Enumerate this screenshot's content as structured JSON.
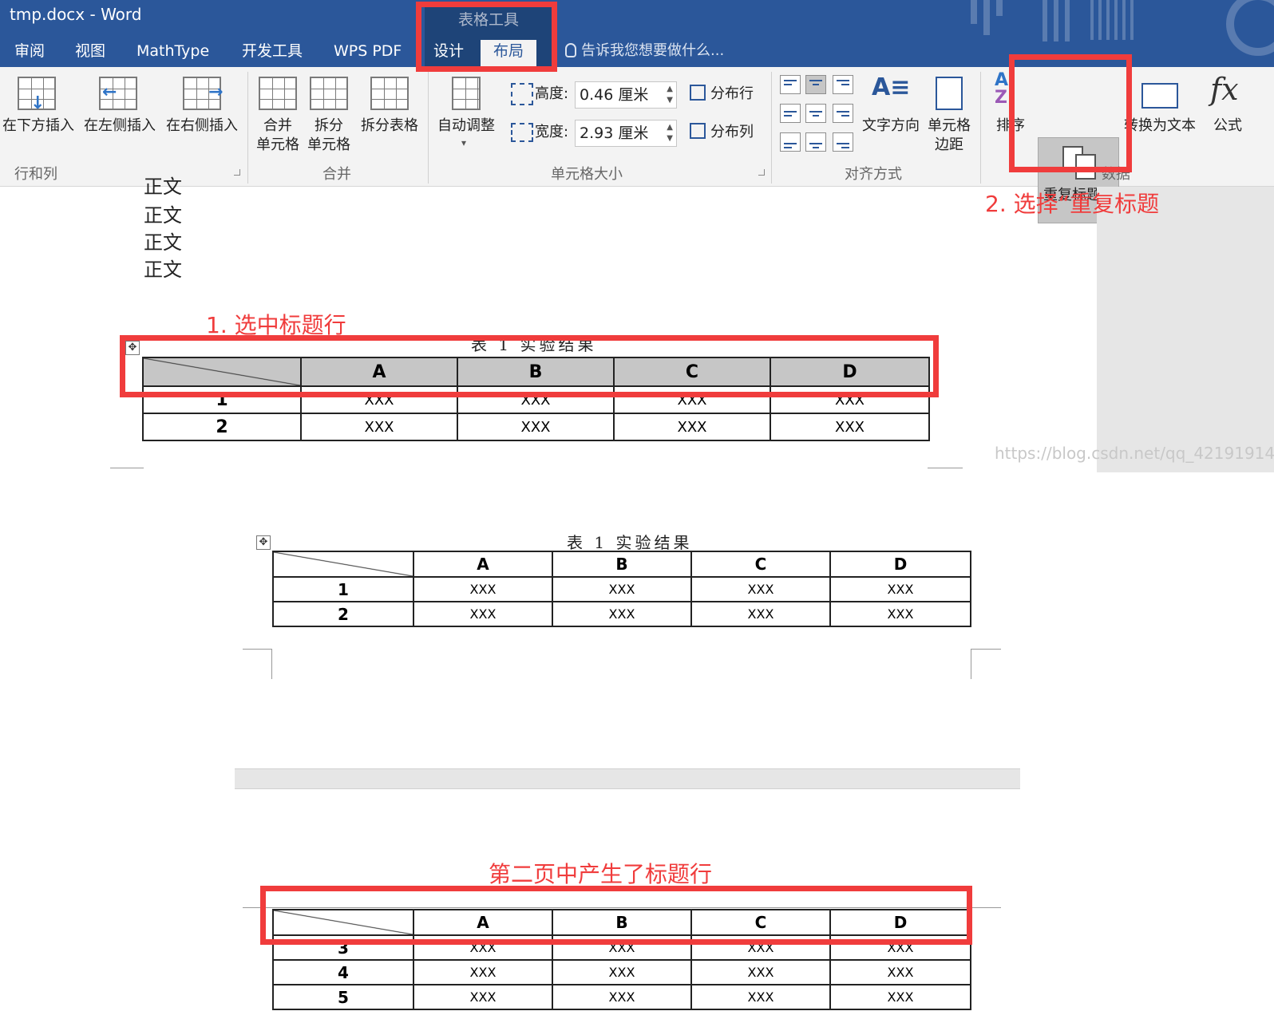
{
  "window": {
    "title": "tmp.docx - Word"
  },
  "context_group": {
    "title": "表格工具"
  },
  "tabs": [
    "审阅",
    "视图",
    "MathType",
    "开发工具",
    "WPS PDF",
    "设计",
    "布局"
  ],
  "tell_me": "告诉我您想要做什么...",
  "ribbon": {
    "rows_cols": {
      "label": "行和列",
      "insert_below": "在下方插入",
      "insert_left": "在左侧插入",
      "insert_right": "在右侧插入"
    },
    "merge": {
      "label": "合并",
      "merge_cells_1": "合并",
      "merge_cells_2": "单元格",
      "split_cells_1": "拆分",
      "split_cells_2": "单元格",
      "split_table": "拆分表格"
    },
    "cell_size": {
      "label": "单元格大小",
      "autofit": "自动调整",
      "height_label": "高度:",
      "height_value": "0.46 厘米",
      "width_label": "宽度:",
      "width_value": "2.93 厘米",
      "distribute_rows": "分布行",
      "distribute_cols": "分布列"
    },
    "alignment": {
      "label": "对齐方式",
      "text_direction": "文字方向",
      "cell_margins_1": "单元格",
      "cell_margins_2": "边距"
    },
    "data": {
      "label": "数据",
      "sort": "排序",
      "repeat_header": "重复标题行",
      "convert_to_text": "转换为文本",
      "formula": "公式"
    }
  },
  "body_lines": [
    "正文",
    "正文",
    "正文",
    "正文"
  ],
  "table": {
    "caption": "表 1 实验结果",
    "headers": [
      "A",
      "B",
      "C",
      "D"
    ],
    "page1_rows": [
      {
        "id": "1",
        "cells": [
          "XXX",
          "XXX",
          "XXX",
          "XXX"
        ]
      },
      {
        "id": "2",
        "cells": [
          "XXX",
          "XXX",
          "XXX",
          "XXX"
        ]
      }
    ],
    "page2_rows": [
      {
        "id": "3",
        "cells": [
          "XXX",
          "XXX",
          "XXX",
          "XXX"
        ]
      },
      {
        "id": "4",
        "cells": [
          "XXX",
          "XXX",
          "XXX",
          "XXX"
        ]
      },
      {
        "id": "5",
        "cells": [
          "XXX",
          "XXX",
          "XXX",
          "XXX"
        ]
      }
    ]
  },
  "annotations": {
    "step1": "1. 选中标题行",
    "step2": "2. 选择“重复标题",
    "step3": "第二页中产生了标题行"
  },
  "watermark": "https://blog.csdn.net/qq_42191914",
  "colors": {
    "word_blue": "#2b579a",
    "annotation_red": "#f03c3c",
    "header_fill": "#c6c6c6"
  }
}
